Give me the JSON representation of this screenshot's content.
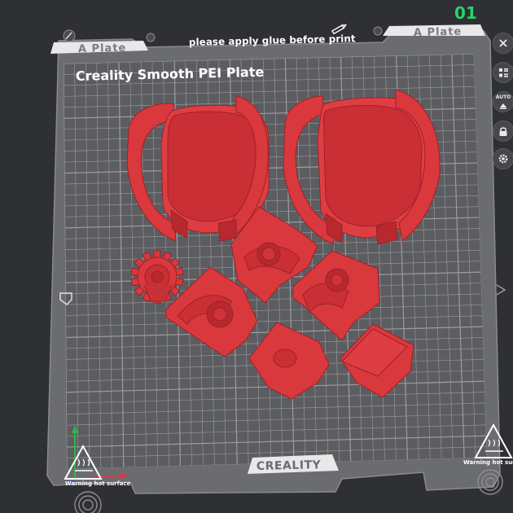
{
  "plate": {
    "index": "01",
    "name": "Creality Smooth PEI Plate",
    "tab_left": "A Plate",
    "tab_right": "A Plate",
    "notice": "please apply glue before print",
    "brand": "CREALITY",
    "warning_left": "Warning hot surface",
    "warning_right": "Warning hot surfac"
  },
  "toolbar": {
    "close": "close-icon",
    "arrange": "arrange-icon",
    "auto_label": "AUTO",
    "auto_orient": "auto-orient-icon",
    "lock": "lock-icon",
    "settings": "gear-icon"
  },
  "colors": {
    "background": "#2f3033",
    "plate_surface": "#5c5d60",
    "plate_frame": "#6b6c70",
    "grid": "#b3b3b5",
    "model": "#d9383d",
    "plate_index": "#27d36b"
  }
}
